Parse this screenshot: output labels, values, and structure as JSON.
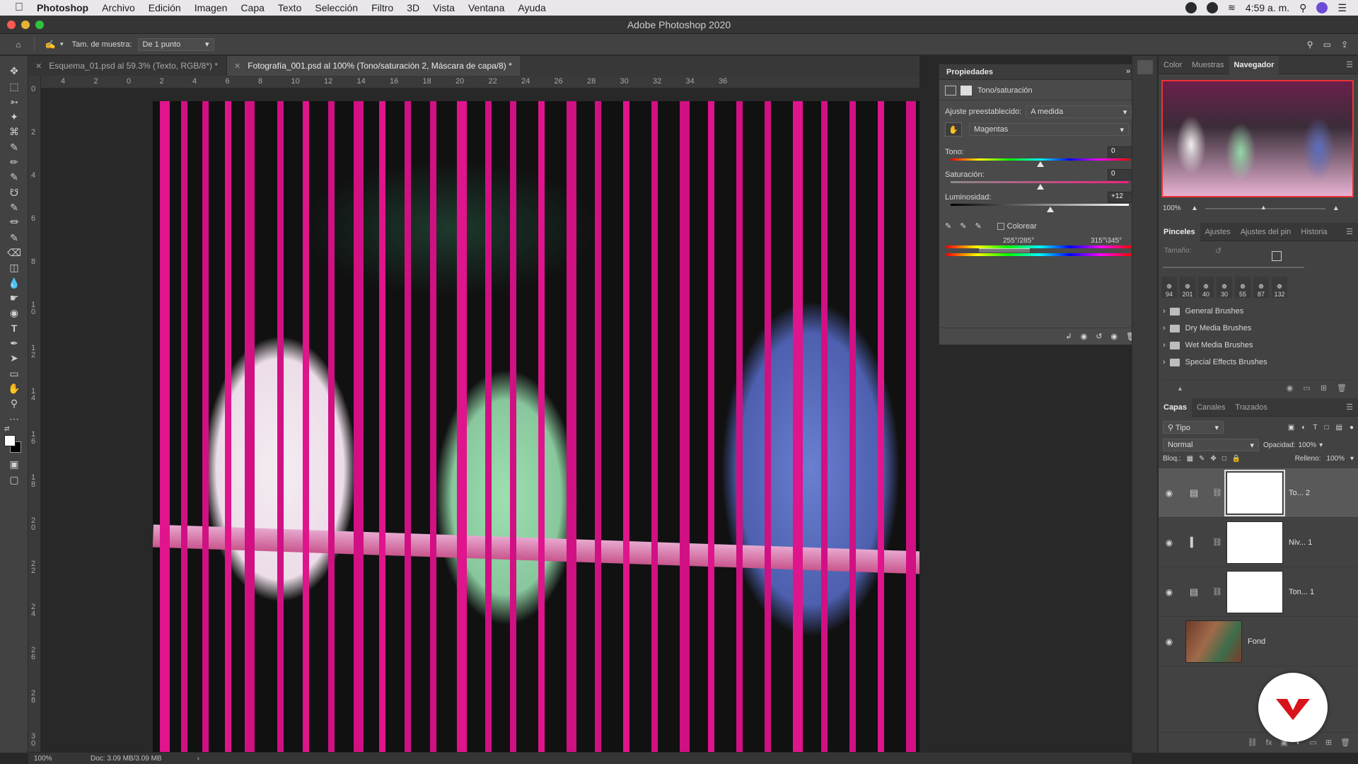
{
  "menubar": {
    "app": "Photoshop",
    "items": [
      "Archivo",
      "Edición",
      "Imagen",
      "Capa",
      "Texto",
      "Selección",
      "Filtro",
      "3D",
      "Vista",
      "Ventana",
      "Ayuda"
    ],
    "clock": "4:59 a. m."
  },
  "window": {
    "title": "Adobe Photoshop 2020"
  },
  "options": {
    "sample_label": "Tam. de muestra:",
    "sample_value": "De 1 punto"
  },
  "tabs": [
    {
      "label": "Esquema_01.psd al 59.3% (Texto, RGB/8*) *",
      "active": false
    },
    {
      "label": "Fotografía_001.psd al 100% (Tono/saturación 2, Máscara de capa/8) *",
      "active": true
    }
  ],
  "ruler": {
    "h_ticks": [
      "4",
      "2",
      "0",
      "2",
      "4",
      "6",
      "8",
      "10",
      "12",
      "14",
      "16",
      "18",
      "20",
      "22",
      "24",
      "26",
      "28",
      "30",
      "32",
      "34",
      "36"
    ],
    "v_ticks": [
      "0",
      "2",
      "4",
      "6",
      "8",
      "1 0",
      "1 2",
      "1 4",
      "1 6",
      "1 8",
      "2 0",
      "2 2",
      "2 4",
      "2 6",
      "2 8",
      "3 0"
    ]
  },
  "properties": {
    "title": "Propiedades",
    "subtitle": "Tono/saturación",
    "preset_label": "Ajuste preestablecido:",
    "preset_value": "A medida",
    "channel_value": "Magentas",
    "hue_label": "Tono:",
    "hue_value": "0",
    "sat_label": "Saturación:",
    "sat_value": "0",
    "light_label": "Luminosidad:",
    "light_value": "+12",
    "colorize_label": "Colorear",
    "range_left": "255°/285°",
    "range_right": "315°\\345°"
  },
  "navigator": {
    "tabs": [
      "Color",
      "Muestras",
      "Navegador"
    ],
    "active_tab": "Navegador",
    "zoom": "100%"
  },
  "brushes": {
    "tabs": [
      "Pinceles",
      "Ajustes",
      "Ajustes del pin",
      "Historia"
    ],
    "active_tab": "Pinceles",
    "size_label": "Tamaño:",
    "presets": [
      "94",
      "201",
      "40",
      "30",
      "55",
      "87",
      "132"
    ],
    "folders": [
      "General Brushes",
      "Dry Media Brushes",
      "Wet Media Brushes",
      "Special Effects Brushes"
    ]
  },
  "layers": {
    "tabs": [
      "Capas",
      "Canales",
      "Trazados"
    ],
    "active_tab": "Capas",
    "filter_label": "Tipo",
    "blend_mode": "Normal",
    "opacity_label": "Opacidad:",
    "opacity_value": "100%",
    "lock_label": "Bloq.:",
    "fill_label": "Relleno:",
    "fill_value": "100%",
    "rows": [
      {
        "name": "To... 2",
        "selected": true
      },
      {
        "name": "Niv... 1",
        "selected": false
      },
      {
        "name": "Ton... 1",
        "selected": false
      },
      {
        "name": "Fond",
        "selected": false
      }
    ]
  },
  "status": {
    "zoom": "100%",
    "doc": "Doc: 3.09 MB/3.09 MB"
  }
}
